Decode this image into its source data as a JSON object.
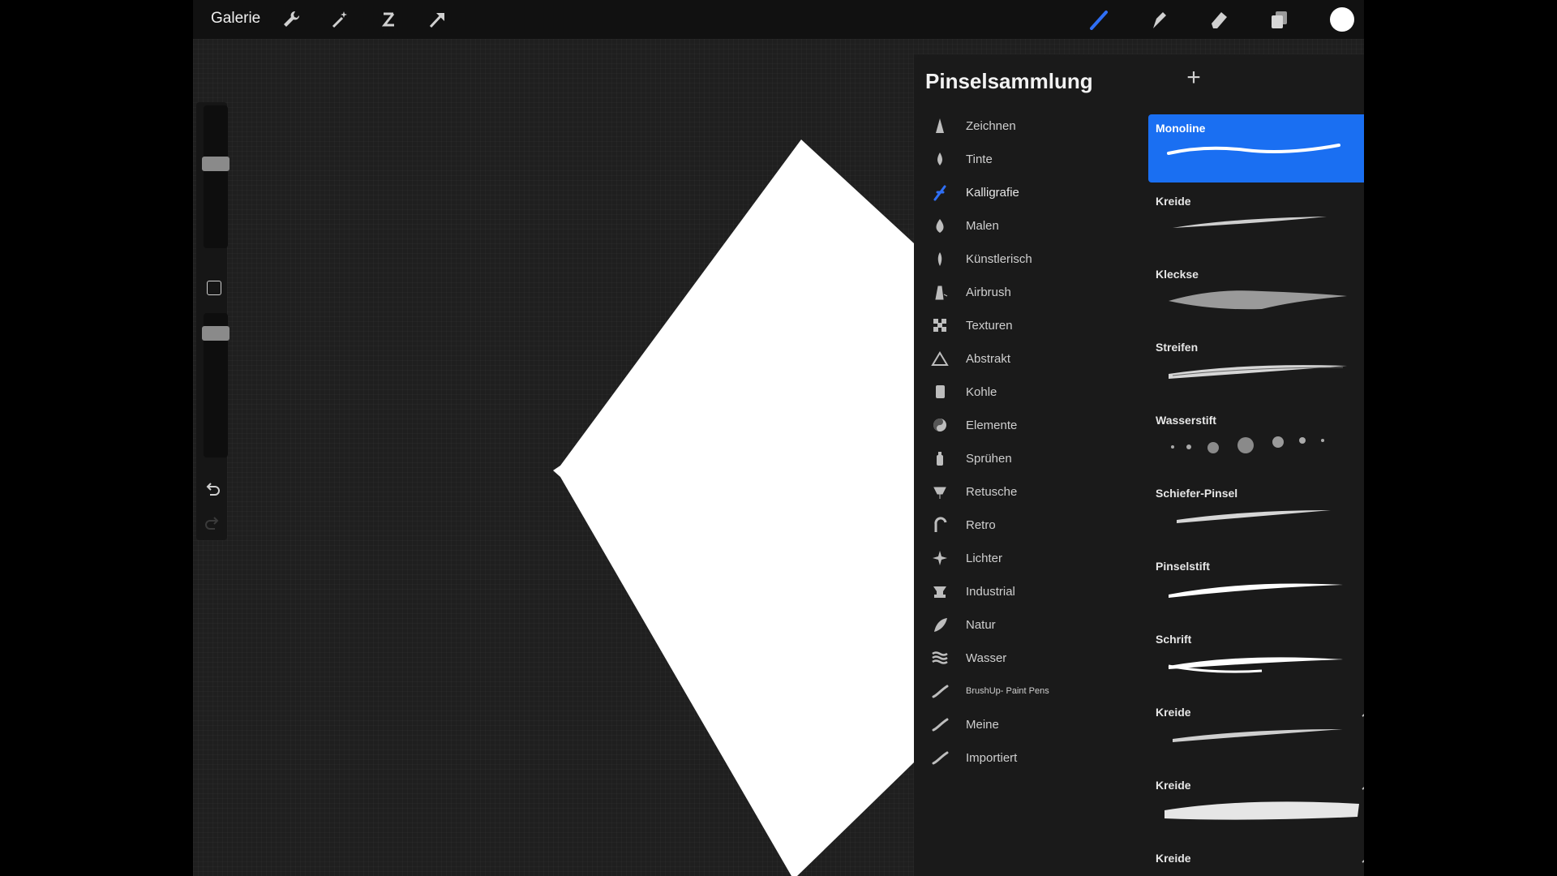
{
  "topbar": {
    "gallery_label": "Galerie",
    "left_icons": [
      "wrench-icon",
      "magic-wand-icon",
      "selection-icon",
      "transform-arrow-icon"
    ],
    "right_icons": [
      "brush-icon",
      "smudge-icon",
      "eraser-icon",
      "layers-icon"
    ],
    "active_tool": "brush",
    "accent_color": "#2f6ff5",
    "current_color": "#ffffff"
  },
  "sidebar": {
    "brush_size_level": 0.6,
    "opacity_level": 0.9,
    "icons": [
      "modify-square-icon",
      "undo-icon",
      "redo-icon"
    ]
  },
  "panel": {
    "title": "Pinselsammlung",
    "add_label": "+",
    "sets": [
      {
        "label": "Zeichnen",
        "icon": "pencil-tip-icon"
      },
      {
        "label": "Tinte",
        "icon": "ink-drop-icon"
      },
      {
        "label": "Kalligrafie",
        "icon": "calligraphy-icon",
        "active": true
      },
      {
        "label": "Malen",
        "icon": "paint-drop-icon"
      },
      {
        "label": "Künstlerisch",
        "icon": "artistic-brush-icon"
      },
      {
        "label": "Airbrush",
        "icon": "airbrush-icon"
      },
      {
        "label": "Texturen",
        "icon": "texture-icon"
      },
      {
        "label": "Abstrakt",
        "icon": "triangle-icon"
      },
      {
        "label": "Kohle",
        "icon": "charcoal-icon"
      },
      {
        "label": "Elemente",
        "icon": "yin-yang-icon"
      },
      {
        "label": "Sprühen",
        "icon": "spray-can-icon"
      },
      {
        "label": "Retusche",
        "icon": "retouch-icon"
      },
      {
        "label": "Retro",
        "icon": "retro-icon"
      },
      {
        "label": "Lichter",
        "icon": "sparkle-icon"
      },
      {
        "label": "Industrial",
        "icon": "anvil-icon"
      },
      {
        "label": "Natur",
        "icon": "leaf-icon"
      },
      {
        "label": "Wasser",
        "icon": "waves-icon"
      },
      {
        "label": "BrushUp- Paint Pens",
        "icon": "stroke-icon"
      },
      {
        "label": "Meine",
        "icon": "stroke-icon"
      },
      {
        "label": "Importiert",
        "icon": "stroke-icon"
      }
    ],
    "brushes": [
      {
        "name": "Monoline",
        "selected": true
      },
      {
        "name": "Kreide"
      },
      {
        "name": "Kleckse"
      },
      {
        "name": "Streifen"
      },
      {
        "name": "Wasserstift"
      },
      {
        "name": "Schiefer-Pinsel"
      },
      {
        "name": "Pinselstift"
      },
      {
        "name": "Schrift"
      },
      {
        "name": "Kreide",
        "imported": true
      },
      {
        "name": "Kreide",
        "imported": true
      },
      {
        "name": "Kreide",
        "imported": true
      }
    ]
  }
}
